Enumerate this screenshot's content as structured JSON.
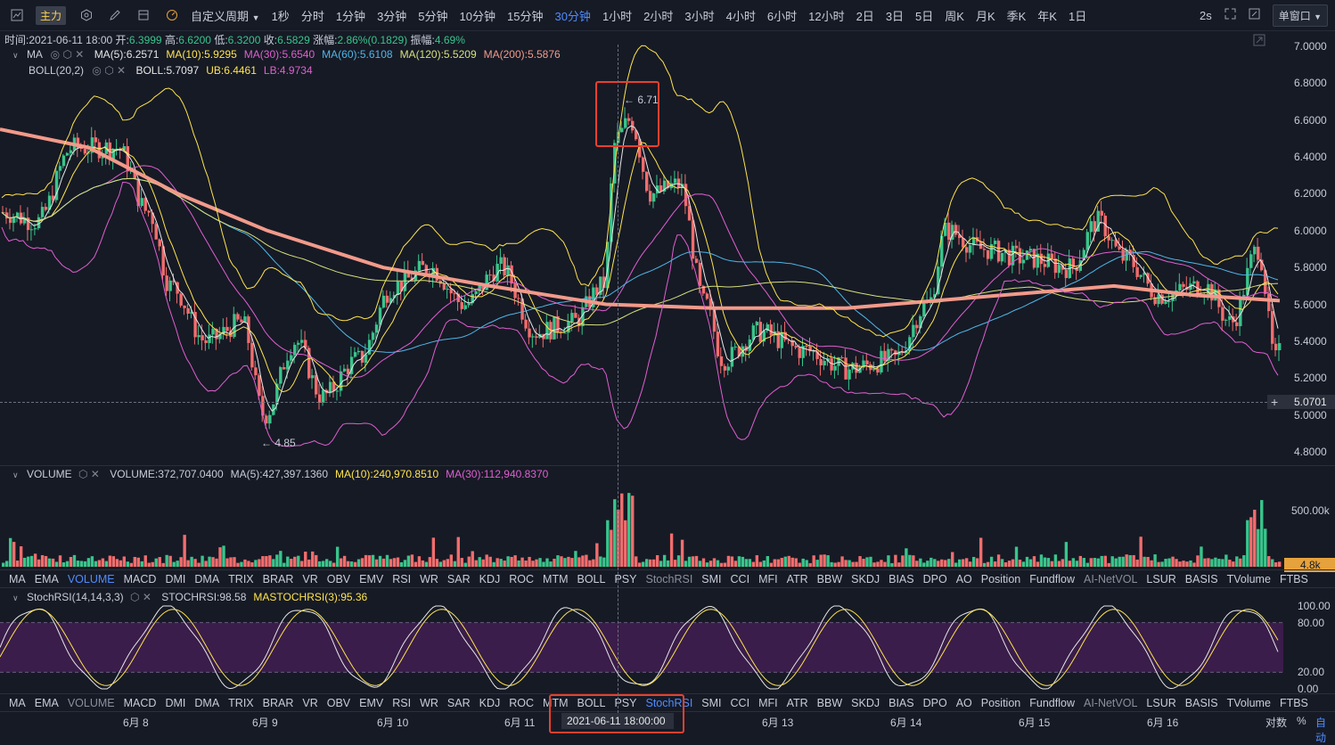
{
  "toolbar": {
    "main_badge": "主力",
    "custom_period": "自定义周期",
    "periods": [
      "1秒",
      "分时",
      "1分钟",
      "3分钟",
      "5分钟",
      "10分钟",
      "15分钟",
      "30分钟",
      "1小时",
      "2小时",
      "3小时",
      "4小时",
      "6小时",
      "12小时",
      "2日",
      "3日",
      "5日",
      "周K",
      "月K",
      "季K",
      "年K",
      "1日"
    ],
    "active_period": "30分钟",
    "refresh": "2s",
    "window_mode": "单窗口"
  },
  "ohlc": {
    "time_label": "时间:2021-06-11 18:00",
    "open_label": "开:",
    "open": "6.3999",
    "high_label": "高:",
    "high": "6.6200",
    "low_label": "低:",
    "low": "6.3200",
    "close_label": "收:",
    "close": "6.5829",
    "change_label": "涨幅:",
    "change": "2.86%(0.1829)",
    "amp_label": "振幅:",
    "amp": "4.69%"
  },
  "ma_line": {
    "name": "MA",
    "items": [
      {
        "text": "MA(5):6.2571",
        "color": "#e6e6e6"
      },
      {
        "text": "MA(10):5.9295",
        "color": "#ffe44d"
      },
      {
        "text": "MA(30):5.6540",
        "color": "#e05fd0"
      },
      {
        "text": "MA(60):5.6108",
        "color": "#4fb6e8"
      },
      {
        "text": "MA(120):5.5209",
        "color": "#d6e07a"
      },
      {
        "text": "MA(200):5.5876",
        "color": "#f29a8a"
      }
    ]
  },
  "boll_line": {
    "name": "BOLL(20,2)",
    "items": [
      {
        "text": "BOLL:5.7097",
        "color": "#e6e6e6"
      },
      {
        "text": "UB:6.4461",
        "color": "#ffe44d"
      },
      {
        "text": "LB:4.9734",
        "color": "#e05fd0"
      }
    ]
  },
  "price_axis": [
    "7.0000",
    "6.8000",
    "6.6000",
    "6.4000",
    "6.2000",
    "6.0000",
    "5.8000",
    "5.6000",
    "5.4000",
    "5.2000",
    "5.0000",
    "4.8000"
  ],
  "cursor_price": "5.0701",
  "high_marker": "← 6.71",
  "low_marker": "← 4.85",
  "volume": {
    "name": "VOLUME",
    "items": [
      {
        "text": "VOLUME:372,707.0400",
        "color": "#c8ccd8"
      },
      {
        "text": "MA(5):427,397.1360",
        "color": "#c8ccd8"
      },
      {
        "text": "MA(10):240,970.8510",
        "color": "#ffe44d"
      },
      {
        "text": "MA(30):112,940.8370",
        "color": "#e05fd0"
      }
    ],
    "axis_label": "500.00k",
    "cursor_label": "4.8k"
  },
  "indicator_tabs": [
    "MA",
    "EMA",
    "VOLUME",
    "MACD",
    "DMI",
    "DMA",
    "TRIX",
    "BRAR",
    "VR",
    "OBV",
    "EMV",
    "RSI",
    "WR",
    "SAR",
    "KDJ",
    "ROC",
    "MTM",
    "BOLL",
    "PSY",
    "StochRSI",
    "SMI",
    "CCI",
    "MFI",
    "ATR",
    "BBW",
    "SKDJ",
    "BIAS",
    "DPO",
    "AO",
    "Position",
    "Fundflow",
    "AI-NetVOL",
    "LSUR",
    "BASIS",
    "TVolume",
    "FTBS"
  ],
  "indicator_tabs_1_active": "VOLUME",
  "indicator_tabs_2_active": "StochRSI",
  "stochrsi": {
    "name": "StochRSI(14,14,3,3)",
    "items": [
      {
        "text": "STOCHRSI:98.58",
        "color": "#c8ccd8"
      },
      {
        "text": "MASTOCHRSI(3):95.36",
        "color": "#ffe44d"
      }
    ],
    "axis": [
      "100.00",
      "80.00",
      "20.00",
      "0.00"
    ]
  },
  "x_axis": {
    "labels": [
      "6月 8",
      "6月 9",
      "6月 10",
      "6月 11",
      "6月 13",
      "6月 14",
      "6月 15",
      "6月 16"
    ],
    "cursor_time": "2021-06-11 18:00:00",
    "log_label": "对数",
    "pct_label": "%",
    "auto_label": "自动"
  }
}
